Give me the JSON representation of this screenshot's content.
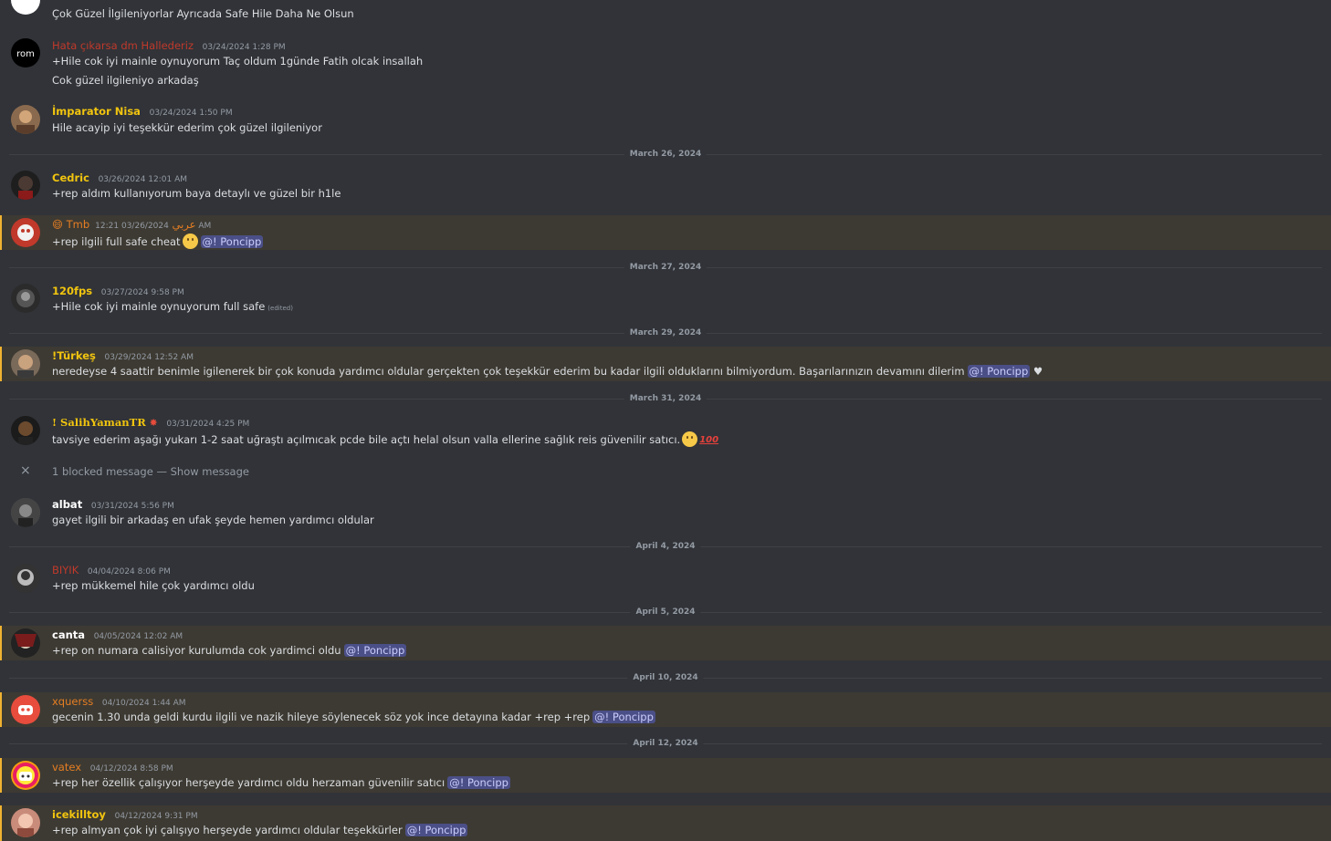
{
  "messages": [
    {
      "text_lines": [
        "Çok Güzel İlgileniyorlar Ayrıcada Safe Hile Daha Ne Olsun"
      ]
    },
    {
      "username": "Hata çıkarsa dm Hallederiz",
      "name_color": "#c0392b",
      "timestamp": "03/24/2024 1:28 PM",
      "text_lines": [
        "+Hile cok iyi mainle oynuyorum Taç oldum 1günde Fatih olcak insallah",
        "Cok güzel ilgileniyo arkadaş"
      ],
      "avatar_text": "rom"
    },
    {
      "username": "İmparator Nisa",
      "name_color": "#f1c40f",
      "timestamp": "03/24/2024 1:50 PM",
      "text_lines": [
        "Hile acayip iyi teşekkür ederim çok güzel ilgileniyor"
      ]
    },
    {
      "username": "Cedric",
      "name_color": "#f1c40f",
      "timestamp": "03/26/2024 12:01 AM",
      "text_lines": [
        "+rep aldım kullanıyorum baya detaylı ve güzel bir h1le"
      ]
    },
    {
      "username": "😄 Tmbعربي",
      "name_color": "#e67e22",
      "timestamp": "03/26/2024 12:21 AM",
      "text": "+rep ilgili   full safe cheat",
      "mention": "@! Poncipp"
    },
    {
      "username": "120fps",
      "name_color": "#f1c40f",
      "timestamp": "03/27/2024 9:58 PM",
      "text": "+Hile cok iyi mainle oynuyorum full safe",
      "edited": "(edited)"
    },
    {
      "username": "!Türkeş",
      "name_color": "#f1c40f",
      "timestamp": "03/29/2024 12:52 AM",
      "text": "neredeyse 4 saattir benimle igilenerek bir çok konuda yardımcı oldular gerçekten çok teşekkür ederim bu kadar ilgili olduklarını bilmiyordum. Başarılarınızın devamını dilerim",
      "mention": "@! Poncipp",
      "suffix": "♥"
    },
    {
      "username": "! SalihYamanTR",
      "name_color": "#f1c40f",
      "timestamp": "03/31/2024 4:25 PM",
      "text": "tavsiye ederim aşağı yukarı 1-2 saat uğraştı açılmıcak pcde bile açtı helal olsun valla ellerine sağlık reis güvenilir satıcı.",
      "hundred": "100"
    },
    {
      "username": "albat",
      "name_color": "#ffffff",
      "timestamp": "03/31/2024 5:56 PM",
      "text": "gayet ilgili bir arkadaş en ufak şeyde hemen yardımcı oldular"
    },
    {
      "username": "BIYIK",
      "name_color": "#c0392b",
      "timestamp": "04/04/2024 8:06 PM",
      "text": "+rep mükkemel hile çok yardımcı oldu"
    },
    {
      "username": "canta",
      "name_color": "#ffffff",
      "timestamp": "04/05/2024 12:02 AM",
      "text": "+rep on numara calisiyor kurulumda cok yardimci oldu",
      "mention": "@! Poncipp"
    },
    {
      "username": "xquerss",
      "name_color": "#e67e22",
      "timestamp": "04/10/2024 1:44 AM",
      "text": "gecenin 1.30 unda geldi kurdu ilgili ve nazik hileye söylenecek söz yok ince detayına kadar +rep +rep",
      "mention": "@! Poncipp"
    },
    {
      "username": "vatex",
      "name_color": "#e67e22",
      "timestamp": "04/12/2024 8:58 PM",
      "text": "+rep her özellik çalışıyor herşeyde yardımcı oldu herzaman güvenilir satıcı",
      "mention": "@! Poncipp"
    },
    {
      "username": "icekilltoy",
      "name_color": "#f1c40f",
      "timestamp": "04/12/2024 9:31 PM",
      "text": "+rep almyan çok iyi çalışıyo herşeyde yardımcı oldular teşekkürler",
      "mention": "@! Poncipp"
    }
  ],
  "dividers": [
    "March 26, 2024",
    "March 27, 2024",
    "March 29, 2024",
    "March 31, 2024",
    "April 4, 2024",
    "April 5, 2024",
    "April 10, 2024",
    "April 12, 2024"
  ],
  "blocked": {
    "text": "1 blocked message — ",
    "link": "Show message"
  },
  "colors": {
    "background": "#313338",
    "mention_bg": "#3d3a33",
    "mention_bar": "#f0b232",
    "mention_pill": "#4b4f87"
  }
}
